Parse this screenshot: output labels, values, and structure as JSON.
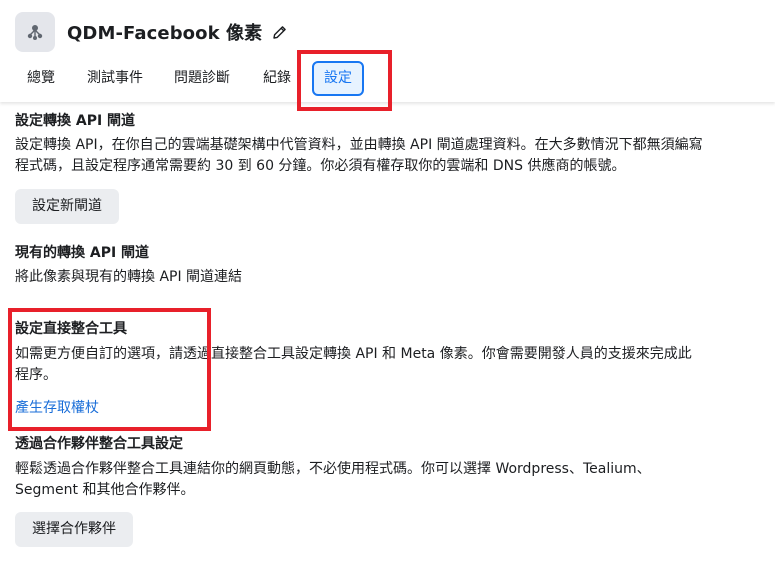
{
  "header": {
    "title": "QDM-Facebook 像素",
    "pixel_icon": "pixel-network-icon",
    "edit_icon": "pencil-icon"
  },
  "tabs": [
    {
      "label": "總覽",
      "active": false
    },
    {
      "label": "測試事件",
      "active": false
    },
    {
      "label": "問題診斷",
      "active": false
    },
    {
      "label": "紀錄",
      "active": false
    },
    {
      "label": "設定",
      "active": true
    }
  ],
  "sections": {
    "setup_gateway": {
      "title": "設定轉換 API 閘道",
      "description": "設定轉換 API，在你自己的雲端基礎架構中代管資料，並由轉換 API 閘道處理資料。在大多數情況下都無須編寫程式碼，且設定程序通常需要約 30 到 60 分鐘。你必須有權存取你的雲端和 DNS 供應商的帳號。",
      "button": "設定新閘道"
    },
    "existing_gateway": {
      "title": "現有的轉換 API 閘道",
      "description": "將此像素與現有的轉換 API 閘道連結"
    },
    "direct_integration": {
      "title": "設定直接整合工具",
      "description": "如需更方便自訂的選項，請透過直接整合工具設定轉換 API 和 Meta 像素。你會需要開發人員的支援來完成此程序。",
      "link": "產生存取權杖"
    },
    "partner_integration": {
      "title": "透過合作夥伴整合工具設定",
      "description": "輕鬆透過合作夥伴整合工具連結你的網頁動態，不必使用程式碼。你可以選擇 Wordpress、Tealium、Segment 和其他合作夥伴。",
      "button": "選擇合作夥伴"
    }
  },
  "colors": {
    "accent": "#1877f2",
    "highlight_box": "#e8202a",
    "link": "#1a6ed8",
    "button_bg": "#ebedf0"
  }
}
